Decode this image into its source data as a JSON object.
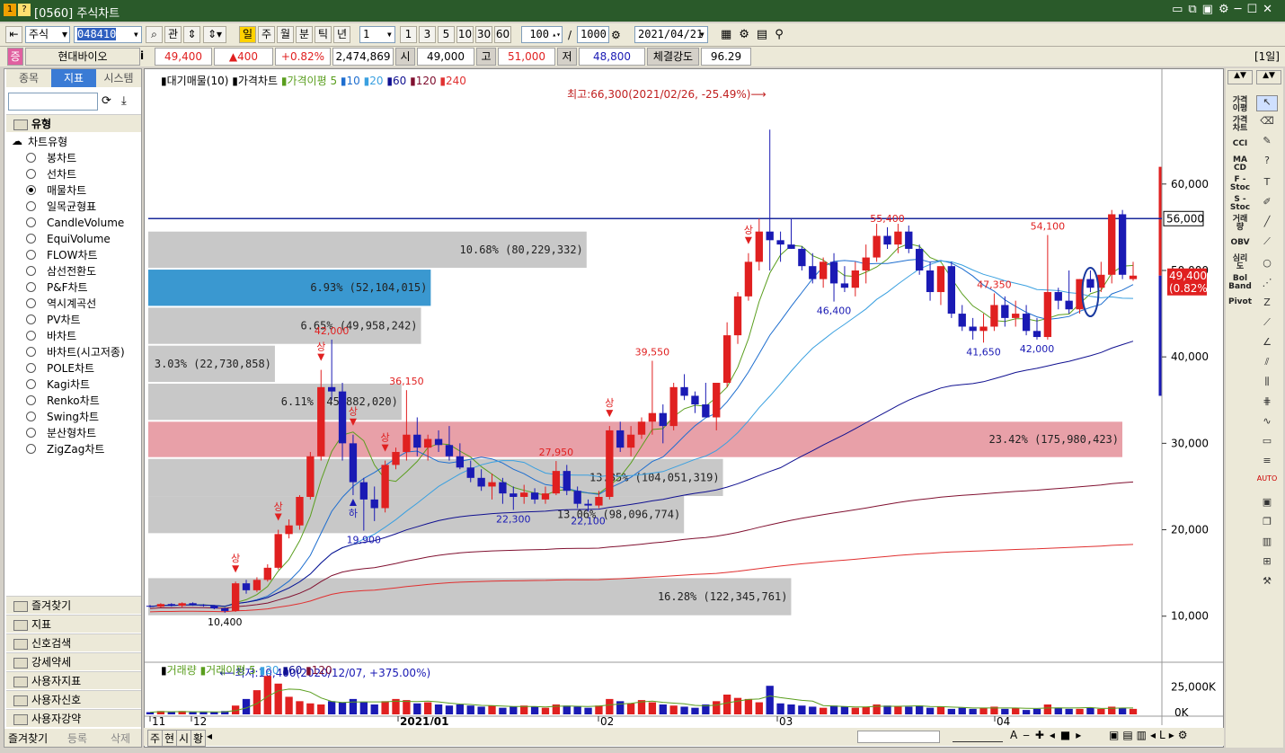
{
  "window": {
    "title": "[0560] 주식차트",
    "icons": [
      "1",
      "?"
    ]
  },
  "toolbar": {
    "market": "주식",
    "code": "048410",
    "periods": [
      "일",
      "주",
      "월",
      "분",
      "틱",
      "년"
    ],
    "interval": "1",
    "quick": [
      "1",
      "3",
      "5",
      "10",
      "30",
      "60"
    ],
    "count": "100",
    "total": "1000",
    "date": "2021/04/21"
  },
  "info": {
    "badge": "증",
    "name": "현대바이오",
    "price": "49,400",
    "change": "▲400",
    "rate": "+0.82%",
    "volume": "2,474,869",
    "open_l": "시",
    "open": "49,000",
    "high_l": "고",
    "high": "51,000",
    "low_l": "저",
    "low": "48,800",
    "str_l": "체결강도",
    "str": "96.29",
    "period": "[1일]"
  },
  "left": {
    "tabs": [
      "종목",
      "지표",
      "시스템"
    ],
    "group": "유형",
    "tree": "차트유형",
    "types": [
      "봉차트",
      "선차트",
      "매물차트",
      "일목균형표",
      "CandleVolume",
      "EquiVolume",
      "FLOW차트",
      "삼선전환도",
      "P&F차트",
      "역시계곡선",
      "PV차트",
      "바차트",
      "바차트(시고저종)",
      "POLE차트",
      "Kagi차트",
      "Renko차트",
      "Swing차트",
      "분산형차트",
      "ZigZag차트"
    ],
    "selected": 2,
    "folders": [
      "즐겨찾기",
      "지표",
      "신호검색",
      "강세약세",
      "사용자지표",
      "사용자신호",
      "사용자강약"
    ],
    "bottom": [
      "즐겨찾기",
      "등록",
      "삭제"
    ]
  },
  "legend": {
    "a": "대기매물(10)",
    "b": "가격차트",
    "c": "가격이평",
    "nums": [
      "5",
      "10",
      "20",
      "60",
      "120",
      "240"
    ]
  },
  "vlegend": {
    "a": "거래량",
    "b": "거래이평",
    "nums": [
      "5",
      "20",
      "60",
      "120"
    ]
  },
  "colors": {
    "up": "#e02020",
    "down": "#1a1ab4",
    "ma5": "#5a9e1e",
    "ma10": "#1e6ecf",
    "ma20": "#3aa0e0",
    "ma60": "#101090",
    "ma120": "#801030",
    "ma240": "#e03030"
  },
  "chart_data": {
    "type": "candlestick",
    "title": "",
    "yticks": [
      10000,
      20000,
      30000,
      40000,
      50000,
      60000
    ],
    "ytick_labels": [
      "10,000",
      "20,000",
      "30,000",
      "40,000",
      "50,000",
      "60,000"
    ],
    "vticks": [
      "25,000K",
      "0K"
    ],
    "xticks": [
      "11",
      "12",
      "2021/01",
      "02",
      "03",
      "04"
    ],
    "ylim": [
      5500,
      71000
    ],
    "hline": {
      "value": 56000,
      "label": "56,000"
    },
    "last": {
      "label": "49,400",
      "pct": "(0.82%)"
    },
    "max_note": "최고:66,300(2021/02/26, -25.49%)⟶",
    "min_note": "⟵최저:10,400(2020/12/07, +375.00%)",
    "profile": [
      {
        "lo": 10000,
        "hi": 14500,
        "pct": "16.28% (122,345,761)",
        "len": 0.66
      },
      {
        "lo": 19500,
        "hi": 24000,
        "pct": "13.06% (98,096,774)",
        "len": 0.55
      },
      {
        "lo": 23800,
        "hi": 28300,
        "pct": "13.85% (104,051,319)",
        "len": 0.59
      },
      {
        "lo": 28300,
        "hi": 32600,
        "pct": "23.42% (175,980,423)",
        "len": 1.0
      },
      {
        "lo": 32600,
        "hi": 37000,
        "pct": "6.11% (45,882,020)",
        "len": 0.26
      },
      {
        "lo": 37000,
        "hi": 41400,
        "pct": "3.03% (22,730,858)",
        "len": 0.13
      },
      {
        "lo": 41400,
        "hi": 45800,
        "pct": "6.65% (49,958,242)",
        "len": 0.28
      },
      {
        "lo": 45800,
        "hi": 50200,
        "pct": "6.93% (52,104,015)",
        "len": 0.29
      },
      {
        "lo": 50200,
        "hi": 54600,
        "pct": "10.68% (80,229,332)",
        "len": 0.45
      }
    ],
    "highlight": {
      "max": 3,
      "cur": 7
    },
    "candles": [
      [
        11200,
        11300,
        11000,
        11100
      ],
      [
        11100,
        11500,
        11000,
        11400
      ],
      [
        11400,
        11500,
        11100,
        11200
      ],
      [
        11200,
        11600,
        11000,
        11500
      ],
      [
        11500,
        11600,
        11200,
        11300
      ],
      [
        11300,
        11400,
        11100,
        11200
      ],
      [
        11200,
        11300,
        10800,
        10900
      ],
      [
        10900,
        11000,
        10400,
        10600
      ],
      [
        10600,
        14000,
        10500,
        13800
      ],
      [
        13800,
        14200,
        12600,
        13000
      ],
      [
        13000,
        14500,
        12800,
        14200
      ],
      [
        14200,
        16000,
        14000,
        15600
      ],
      [
        15600,
        20000,
        15400,
        19500
      ],
      [
        19500,
        21200,
        19000,
        20500
      ],
      [
        20500,
        24000,
        20000,
        23800
      ],
      [
        23800,
        29000,
        23500,
        28500
      ],
      [
        28500,
        38500,
        28000,
        36500
      ],
      [
        36500,
        42000,
        35000,
        36000
      ],
      [
        36000,
        37000,
        28000,
        30000
      ],
      [
        30000,
        31000,
        24000,
        25500
      ],
      [
        25500,
        26000,
        19900,
        23500
      ],
      [
        23500,
        25000,
        21000,
        22500
      ],
      [
        22500,
        28000,
        22000,
        27500
      ],
      [
        27500,
        29500,
        27000,
        29000
      ],
      [
        29000,
        36150,
        28000,
        31000
      ],
      [
        31000,
        33000,
        28500,
        29500
      ],
      [
        29500,
        31000,
        28000,
        30500
      ],
      [
        30500,
        31500,
        29000,
        29800
      ],
      [
        29800,
        32000,
        28000,
        28500
      ],
      [
        28500,
        30000,
        27000,
        27200
      ],
      [
        27200,
        28000,
        25500,
        26000
      ],
      [
        26000,
        27000,
        24500,
        25000
      ],
      [
        25000,
        26500,
        23500,
        25500
      ],
      [
        25500,
        26000,
        23000,
        24200
      ],
      [
        24200,
        25000,
        22300,
        23800
      ],
      [
        23800,
        25200,
        23000,
        24300
      ],
      [
        24300,
        24800,
        23000,
        23500
      ],
      [
        23500,
        25000,
        23000,
        24200
      ],
      [
        24200,
        27950,
        24000,
        26800
      ],
      [
        26800,
        27500,
        24000,
        24500
      ],
      [
        24500,
        25000,
        22500,
        23000
      ],
      [
        23000,
        23500,
        22100,
        22800
      ],
      [
        22800,
        24500,
        22500,
        23800
      ],
      [
        23800,
        32000,
        23500,
        31500
      ],
      [
        31500,
        32500,
        29000,
        29500
      ],
      [
        29500,
        32000,
        28500,
        31000
      ],
      [
        31000,
        33000,
        30500,
        32500
      ],
      [
        32500,
        39550,
        31000,
        33500
      ],
      [
        33500,
        34500,
        30000,
        32000
      ],
      [
        32000,
        37000,
        31500,
        36500
      ],
      [
        36500,
        38000,
        35000,
        35500
      ],
      [
        35500,
        36000,
        33500,
        34500
      ],
      [
        34500,
        37000,
        33000,
        33000
      ],
      [
        33000,
        35000,
        31500,
        37000
      ],
      [
        37000,
        44000,
        36500,
        42500
      ],
      [
        42500,
        47500,
        41500,
        47000
      ],
      [
        47000,
        52000,
        46500,
        51000
      ],
      [
        51000,
        56000,
        50000,
        54500
      ],
      [
        54500,
        66300,
        50000,
        53500
      ],
      [
        53500,
        54500,
        51000,
        53000
      ],
      [
        53000,
        56000,
        52500,
        52500
      ],
      [
        52500,
        52800,
        50000,
        50500
      ],
      [
        50500,
        52000,
        48500,
        49000
      ],
      [
        49000,
        51500,
        48000,
        51000
      ],
      [
        51000,
        52000,
        46400,
        48500
      ],
      [
        48500,
        50500,
        47500,
        48000
      ],
      [
        48000,
        51000,
        47000,
        50000
      ],
      [
        50000,
        53000,
        48500,
        51500
      ],
      [
        51500,
        55400,
        51000,
        54000
      ],
      [
        54000,
        55000,
        52500,
        53000
      ],
      [
        53000,
        55400,
        52000,
        54500
      ],
      [
        54500,
        55200,
        52000,
        52500
      ],
      [
        52500,
        53000,
        49500,
        50000
      ],
      [
        50000,
        51000,
        46500,
        47500
      ],
      [
        47500,
        49500,
        46000,
        50500
      ],
      [
        50500,
        51000,
        44500,
        45000
      ],
      [
        45000,
        46000,
        43000,
        43500
      ],
      [
        43500,
        44500,
        42000,
        43000
      ],
      [
        43000,
        45000,
        41650,
        43500
      ],
      [
        43500,
        47350,
        43000,
        46000
      ],
      [
        46000,
        47000,
        43500,
        44500
      ],
      [
        44500,
        46500,
        43500,
        45000
      ],
      [
        45000,
        46000,
        42500,
        43000
      ],
      [
        43000,
        44500,
        42000,
        42300
      ],
      [
        42300,
        54100,
        42000,
        47500
      ],
      [
        47500,
        48000,
        45500,
        46500
      ],
      [
        46500,
        50000,
        45000,
        45500
      ],
      [
        45500,
        49000,
        45000,
        49000
      ],
      [
        49000,
        50000,
        47500,
        48000
      ],
      [
        48000,
        51000,
        47500,
        49500
      ],
      [
        49500,
        57000,
        48500,
        56500
      ],
      [
        56500,
        57000,
        49000,
        49500
      ],
      [
        49000,
        51000,
        48800,
        49400
      ]
    ],
    "annotations": [
      {
        "i": 7,
        "text": "10,400",
        "pos": "below",
        "color": "#000"
      },
      {
        "i": 20,
        "text": "19,900",
        "pos": "below",
        "color": "#1a1ab4"
      },
      {
        "i": 24,
        "text": "36,150",
        "pos": "above",
        "color": "#e02020"
      },
      {
        "i": 34,
        "text": "22,300",
        "pos": "below",
        "color": "#1a1ab4"
      },
      {
        "i": 41,
        "text": "22,100",
        "pos": "below",
        "color": "#1a1ab4"
      },
      {
        "i": 47,
        "text": "39,550",
        "pos": "above",
        "color": "#e02020"
      },
      {
        "i": 38,
        "text": "27,950",
        "pos": "above",
        "color": "#e02020"
      },
      {
        "i": 64,
        "text": "46,400",
        "pos": "below",
        "color": "#1a1ab4"
      },
      {
        "i": 69,
        "text": "55,400",
        "pos": "above",
        "color": "#e02020"
      },
      {
        "i": 78,
        "text": "41,650",
        "pos": "below",
        "color": "#1a1ab4"
      },
      {
        "i": 79,
        "text": "47,350",
        "pos": "above",
        "color": "#e02020"
      },
      {
        "i": 83,
        "text": "42,000",
        "pos": "below",
        "color": "#1a1ab4"
      },
      {
        "i": 84,
        "text": "54,100",
        "pos": "above",
        "color": "#e02020"
      },
      {
        "i": 17,
        "text": "42,000",
        "pos": "above",
        "color": "#e02020"
      }
    ],
    "signals": [
      8,
      12,
      16,
      19,
      22,
      43,
      56
    ],
    "signal_text": "상",
    "signal_down_text": "하",
    "signal_down": [
      19
    ],
    "volumes": [
      2,
      3,
      2,
      3,
      2,
      2,
      2,
      3,
      8,
      14,
      22,
      35,
      28,
      16,
      12,
      10,
      9,
      12,
      11,
      14,
      11,
      9,
      12,
      14,
      13,
      10,
      11,
      9,
      8,
      9,
      8,
      7,
      8,
      6,
      7,
      8,
      7,
      6,
      9,
      8,
      7,
      6,
      8,
      14,
      12,
      10,
      13,
      11,
      9,
      8,
      7,
      6,
      9,
      12,
      18,
      15,
      14,
      11,
      26,
      10,
      9,
      8,
      7,
      6,
      8,
      7,
      6,
      7,
      9,
      8,
      7,
      7,
      8,
      6,
      7,
      5,
      6,
      5,
      6,
      7,
      5,
      6,
      4,
      5,
      9,
      6,
      5,
      5,
      6,
      5,
      7,
      6,
      5
    ],
    "vmax": 36
  },
  "bottombar": {
    "tabs": [
      "주",
      "현",
      "시",
      "황"
    ]
  }
}
